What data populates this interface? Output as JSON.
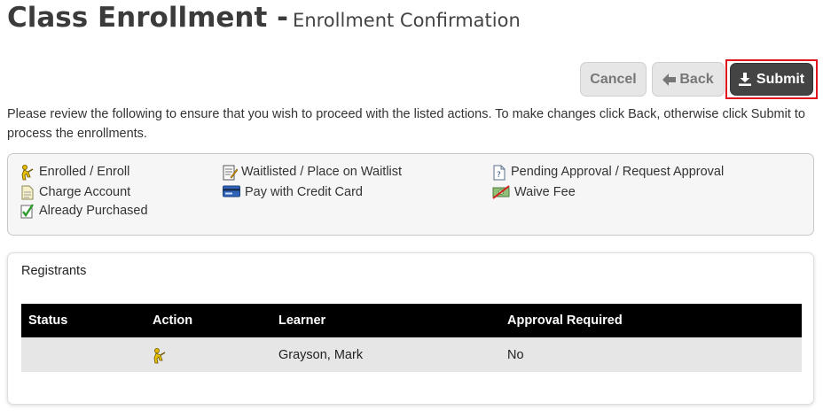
{
  "page": {
    "title": "Class Enrollment -",
    "subtitle": "Enrollment Confirmation"
  },
  "buttons": {
    "cancel": "Cancel",
    "back": "Back",
    "submit": "Submit"
  },
  "intro_text": "Please review the following to ensure that you wish to proceed with the listed actions. To make changes click Back, otherwise click Submit to process the enrollments.",
  "legend": {
    "enrolled": {
      "label": "Enrolled / Enroll",
      "icon": "enroll-figure-icon"
    },
    "waitlisted": {
      "label": "Waitlisted / Place on Waitlist",
      "icon": "waitlist-notepad-icon"
    },
    "pending": {
      "label": "Pending Approval / Request Approval",
      "icon": "pending-document-question-icon"
    },
    "charge": {
      "label": "Charge Account",
      "icon": "charge-account-document-icon"
    },
    "credit": {
      "label": "Pay with Credit Card",
      "icon": "credit-card-icon"
    },
    "waive": {
      "label": "Waive Fee",
      "icon": "waive-fee-money-icon"
    },
    "purchased": {
      "label": "Already Purchased",
      "icon": "already-purchased-check-icon"
    }
  },
  "registrants": {
    "title": "Registrants",
    "columns": [
      "Status",
      "Action",
      "Learner",
      "Approval Required"
    ],
    "rows": [
      {
        "status": "",
        "action_icon": "enroll-figure-icon",
        "learner": "Grayson, Mark",
        "approval_required": "No"
      }
    ]
  },
  "colors": {
    "submit_bg": "#444444",
    "highlight_border": "#e0141c",
    "table_header_bg": "#000000",
    "row_bg": "#e6e6e6",
    "legend_bg": "#f6f6f6"
  }
}
